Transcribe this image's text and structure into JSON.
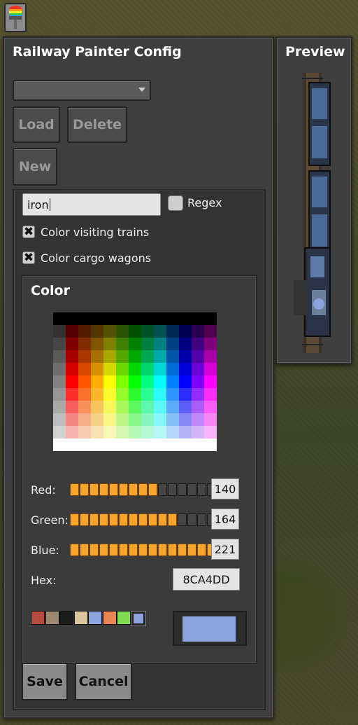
{
  "toolbar": {
    "painter_icon": "rainbow-brush-icon"
  },
  "config": {
    "title": "Railway Painter Config",
    "dropdown_value": "",
    "load_label": "Load",
    "delete_label": "Delete",
    "new_label": "New",
    "filter_value": "iron",
    "regex_label": "Regex",
    "regex_checked": false,
    "visiting_label": "Color visiting trains",
    "visiting_checked": true,
    "cargo_label": "Color cargo wagons",
    "cargo_checked": true,
    "color": {
      "title": "Color",
      "red_label": "Red:",
      "red_value": "140",
      "red_fill": 0.55,
      "green_label": "Green:",
      "green_value": "164",
      "green_fill": 0.64,
      "blue_label": "Blue:",
      "blue_value": "221",
      "blue_fill": 0.87,
      "hex_label": "Hex:",
      "hex_value": "8CA4DD",
      "preview_color": "#8CA4DD",
      "presets": [
        "#b64a40",
        "#9b8a70",
        "#1c1c1c",
        "#d8c79e",
        "#8ca4dd",
        "#e98453",
        "#7fda4f",
        "#8ca4dd"
      ]
    },
    "save_label": "Save",
    "cancel_label": "Cancel"
  },
  "preview": {
    "title": "Preview"
  }
}
